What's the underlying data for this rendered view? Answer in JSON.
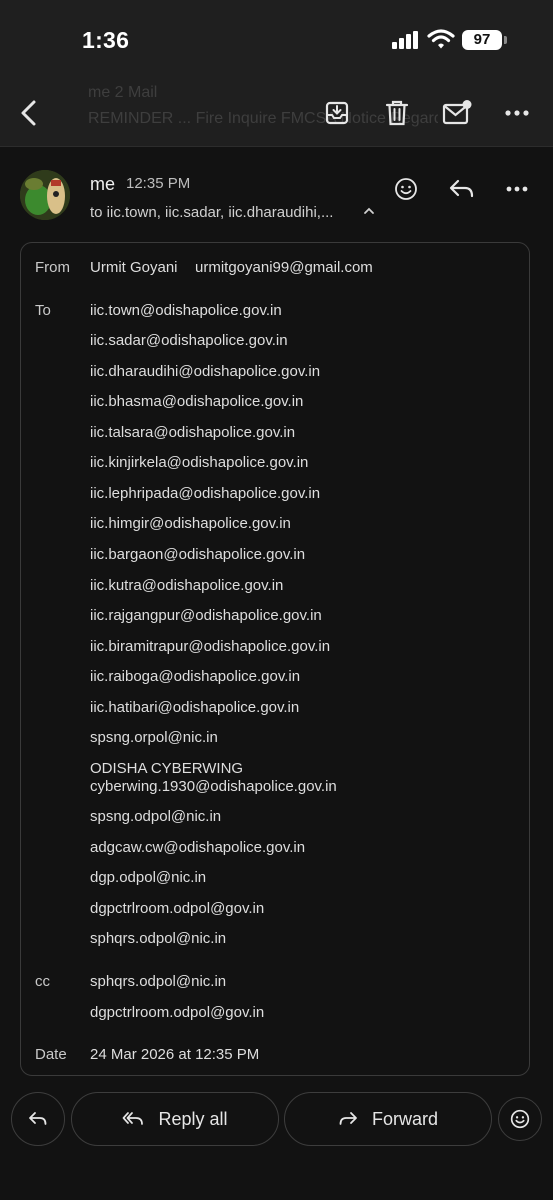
{
  "status_bar": {
    "time": "1:36",
    "battery": "97"
  },
  "toolbar": {
    "ghost_subject_1": "me 2 Mail",
    "ghost_subject_2": "REMINDER ... Fire Inquire FMCSA Notice Regarding..."
  },
  "message": {
    "sender": "me",
    "time": "12:35 PM",
    "recipients_summary": "to iic.town, iic.sadar, iic.dharaudihi,..."
  },
  "details": {
    "from_label": "From",
    "from_name": "Urmit Goyani",
    "from_email": "urmitgoyani99@gmail.com",
    "to_label": "To",
    "to": [
      "iic.town@odishapolice.gov.in",
      "iic.sadar@odishapolice.gov.in",
      "iic.dharaudihi@odishapolice.gov.in",
      "iic.bhasma@odishapolice.gov.in",
      "iic.talsara@odishapolice.gov.in",
      "iic.kinjirkela@odishapolice.gov.in",
      "iic.lephripada@odishapolice.gov.in",
      "iic.himgir@odishapolice.gov.in",
      "iic.bargaon@odishapolice.gov.in",
      "iic.kutra@odishapolice.gov.in",
      "iic.rajgangpur@odishapolice.gov.in",
      "iic.biramitrapur@odishapolice.gov.in",
      "iic.raiboga@odishapolice.gov.in",
      "iic.hatibari@odishapolice.gov.in",
      "spsng.orpol@nic.in"
    ],
    "to_named": {
      "name": "ODISHA CYBERWING",
      "email": "cyberwing.1930@odishapolice.gov.in"
    },
    "to_more": [
      "spsng.odpol@nic.in",
      "adgcaw.cw@odishapolice.gov.in",
      "dgp.odpol@nic.in",
      "dgpctrlroom.odpol@gov.in",
      "sphqrs.odpol@nic.in"
    ],
    "cc_label": "cc",
    "cc": [
      "sphqrs.odpol@nic.in",
      "dgpctrlroom.odpol@gov.in"
    ],
    "date_label": "Date",
    "date": "24 Mar 2026 at 12:35 PM"
  },
  "actions": {
    "reply_all": "Reply all",
    "forward": "Forward"
  },
  "icons": {
    "back": "back-arrow-icon",
    "archive": "archive-icon",
    "delete": "trash-icon",
    "mark_unread": "mark-unread-icon",
    "more": "more-icon",
    "emoji": "emoji-icon",
    "reply": "reply-icon",
    "reply_all": "reply-all-icon",
    "forward": "forward-icon"
  }
}
